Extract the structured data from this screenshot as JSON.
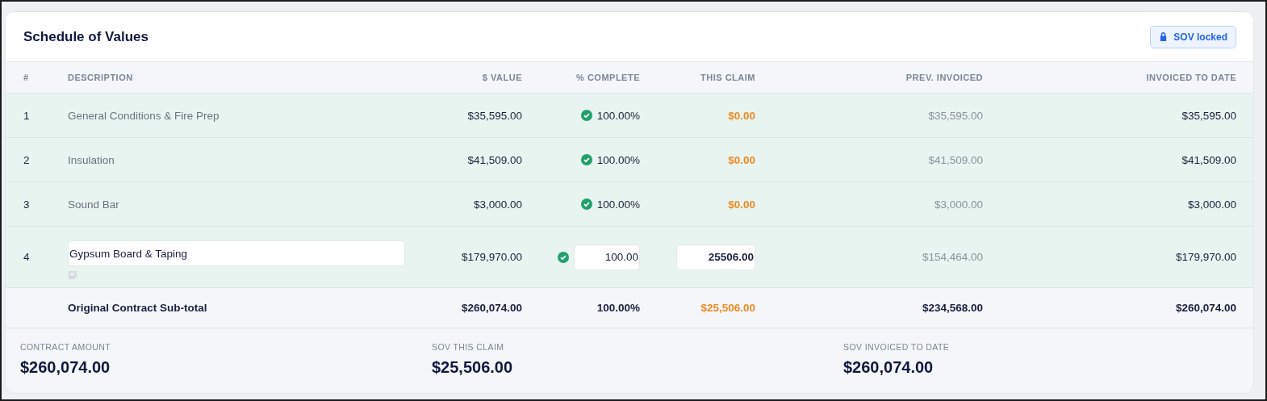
{
  "title": "Schedule of Values",
  "lock_badge": {
    "label": "SOV locked",
    "locked": true
  },
  "columns": [
    "#",
    "DESCRIPTION",
    "$ VALUE",
    "% COMPLETE",
    "THIS CLAIM",
    "PREV. INVOICED",
    "INVOICED TO DATE"
  ],
  "rows": [
    {
      "kind": "static",
      "number": "1",
      "description": "General Conditions & Fire Prep",
      "value": "$35,595.00",
      "complete": true,
      "percent_complete": "100.00%",
      "this_claim": "$0.00",
      "prev_invoiced": "$35,595.00",
      "invoiced_to_date": "$35,595.00"
    },
    {
      "kind": "static",
      "number": "2",
      "description": "Insulation",
      "value": "$41,509.00",
      "complete": true,
      "percent_complete": "100.00%",
      "this_claim": "$0.00",
      "prev_invoiced": "$41,509.00",
      "invoiced_to_date": "$41,509.00"
    },
    {
      "kind": "static",
      "number": "3",
      "description": "Sound Bar",
      "value": "$3,000.00",
      "complete": true,
      "percent_complete": "100.00%",
      "this_claim": "$0.00",
      "prev_invoiced": "$3,000.00",
      "invoiced_to_date": "$3,000.00"
    },
    {
      "kind": "editable",
      "number": "4",
      "description": "Gypsum Board & Taping",
      "value": "$179,970.00",
      "complete": true,
      "percent_complete": "100.00",
      "this_claim": "25506.00",
      "prev_invoiced": "$154,464.00",
      "invoiced_to_date": "$179,970.00"
    }
  ],
  "subtotal": {
    "label": "Original Contract Sub-total",
    "value": "$260,074.00",
    "percent_complete": "100.00%",
    "this_claim": "$25,506.00",
    "prev_invoiced": "$234,568.00",
    "invoiced_to_date": "$260,074.00"
  },
  "summary": [
    {
      "label": "CONTRACT AMOUNT",
      "amount": "$260,074.00"
    },
    {
      "label": "SOV THIS CLAIM",
      "amount": "$25,506.00"
    },
    {
      "label": "SOV INVOICED TO DATE",
      "amount": "$260,074.00"
    }
  ]
}
